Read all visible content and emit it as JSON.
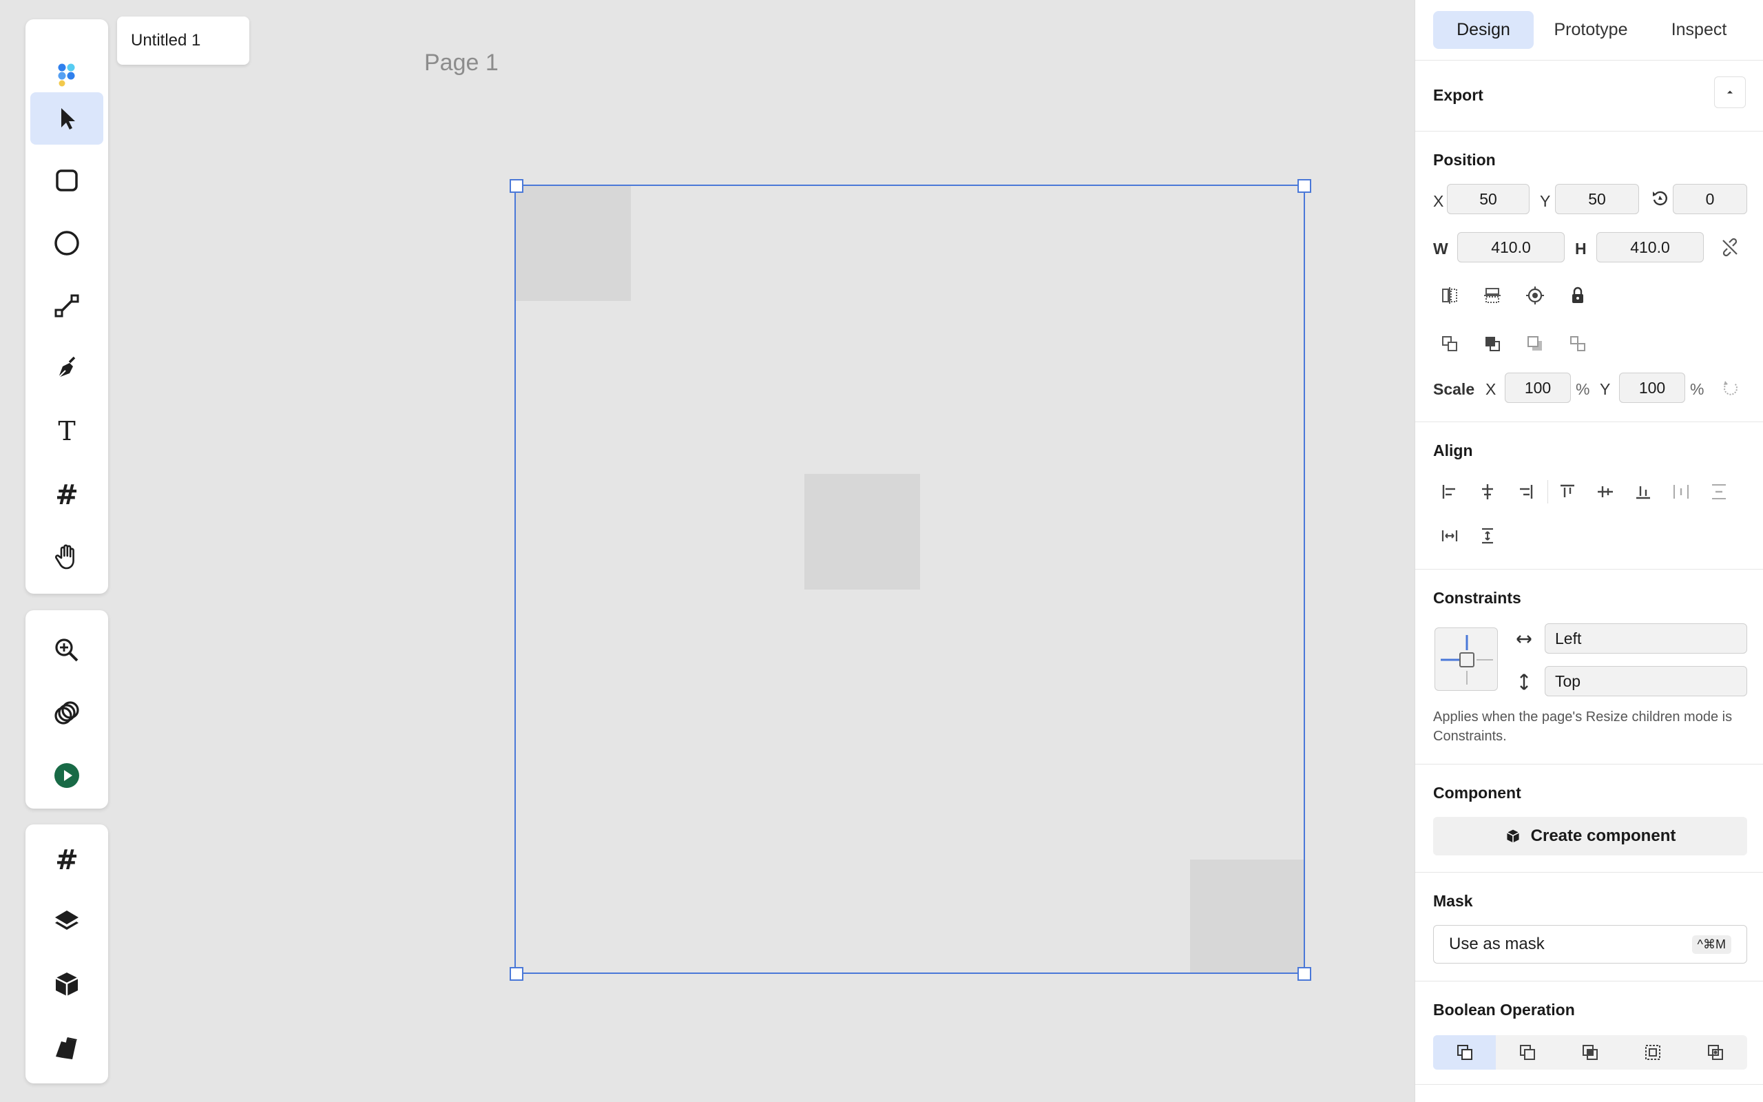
{
  "document": {
    "tab_title": "Untitled 1",
    "page_label": "Page 1"
  },
  "toolbar": {
    "tools": [
      "app-logo",
      "move-tool",
      "rectangle-tool",
      "ellipse-tool",
      "line-tool",
      "pen-tool",
      "text-tool",
      "frame-tool",
      "hand-tool"
    ],
    "view_tools": [
      "zoom-tool",
      "components-tool",
      "play-button"
    ],
    "panels": [
      "frames-panel",
      "layers-panel",
      "assets-panel",
      "styles-panel"
    ],
    "play_color": "#186a46",
    "accent": "#4a78d8"
  },
  "panel": {
    "tabs": {
      "design": "Design",
      "prototype": "Prototype",
      "inspect": "Inspect"
    },
    "export": {
      "title": "Export"
    },
    "position": {
      "title": "Position",
      "x_label": "X",
      "x": "50",
      "y_label": "Y",
      "y": "50",
      "rotation": "0",
      "w_label": "W",
      "w": "410.0",
      "h_label": "H",
      "h": "410.0"
    },
    "scale": {
      "title": "Scale",
      "x_label": "X",
      "x": "100",
      "x_unit": "%",
      "y_label": "Y",
      "y": "100",
      "y_unit": "%"
    },
    "align": {
      "title": "Align"
    },
    "constraints": {
      "title": "Constraints",
      "horizontal": "Left",
      "vertical": "Top",
      "note": "Applies when the page's Resize children mode is Constraints."
    },
    "component": {
      "title": "Component",
      "create_label": "Create component"
    },
    "mask": {
      "title": "Mask",
      "use_label": "Use as mask",
      "shortcut": "^⌘M"
    },
    "boolean": {
      "title": "Boolean Operation"
    }
  }
}
